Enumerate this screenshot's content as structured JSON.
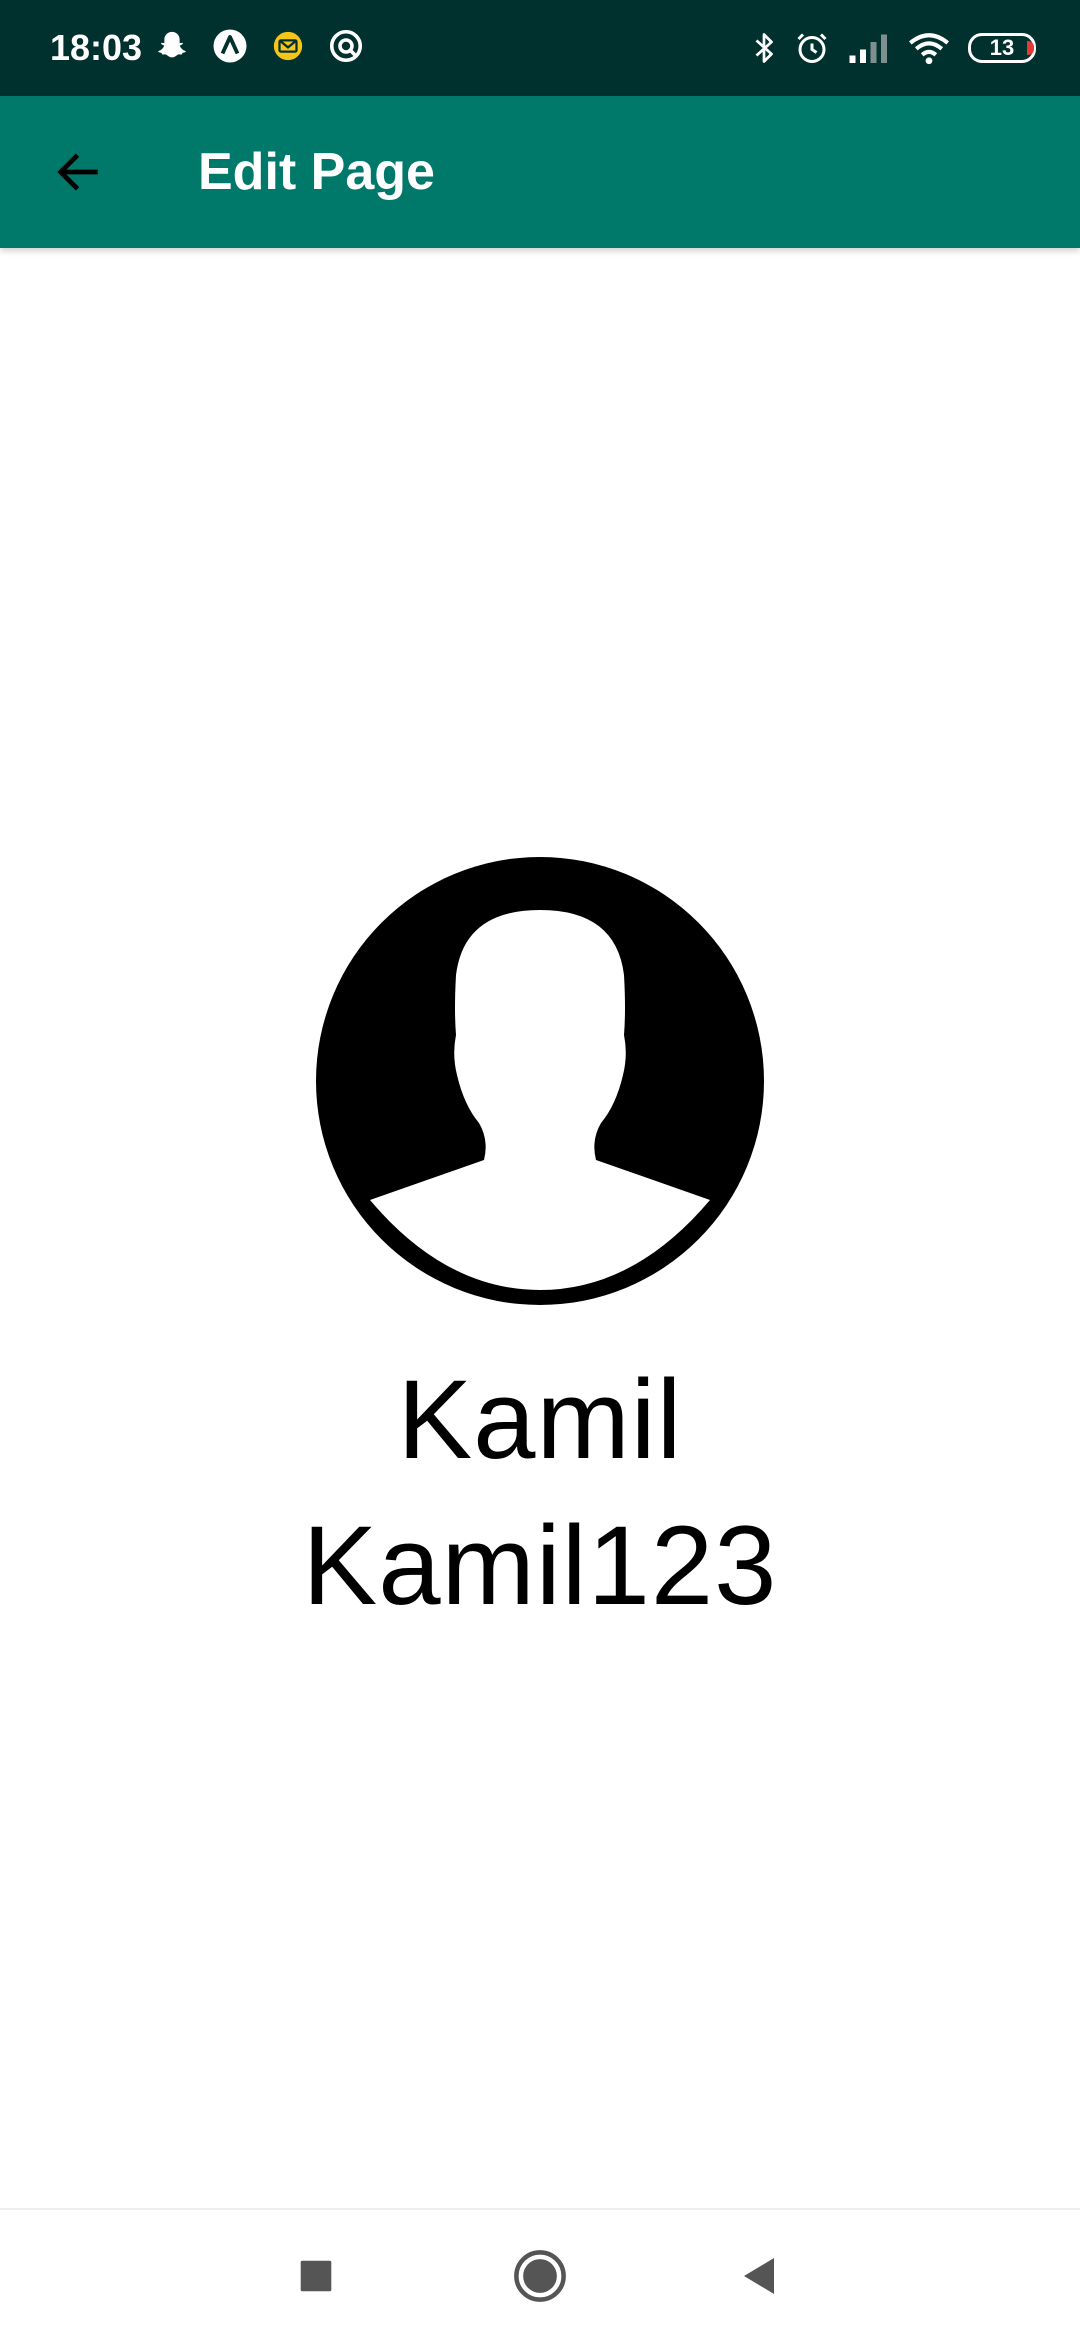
{
  "status_bar": {
    "time": "18:03",
    "battery_level": "13",
    "left_icons": [
      "snapchat-icon",
      "arc-icon",
      "mail-icon",
      "vpn-icon"
    ],
    "right_icons": [
      "bluetooth-icon",
      "alarm-icon",
      "signal-icon",
      "wifi-icon",
      "battery-icon"
    ]
  },
  "app_bar": {
    "title": "Edit Page",
    "back_icon": "arrow-back-icon",
    "background": "#00796b"
  },
  "profile": {
    "avatar_icon": "account-circle-icon",
    "display_name": "Kamil",
    "username": "Kamil123"
  },
  "nav_bar": {
    "buttons": [
      "recents-icon",
      "home-icon",
      "back-icon"
    ]
  },
  "colors": {
    "status_bar": "#00312f",
    "app_bar": "#00796b",
    "text": "#000000"
  }
}
